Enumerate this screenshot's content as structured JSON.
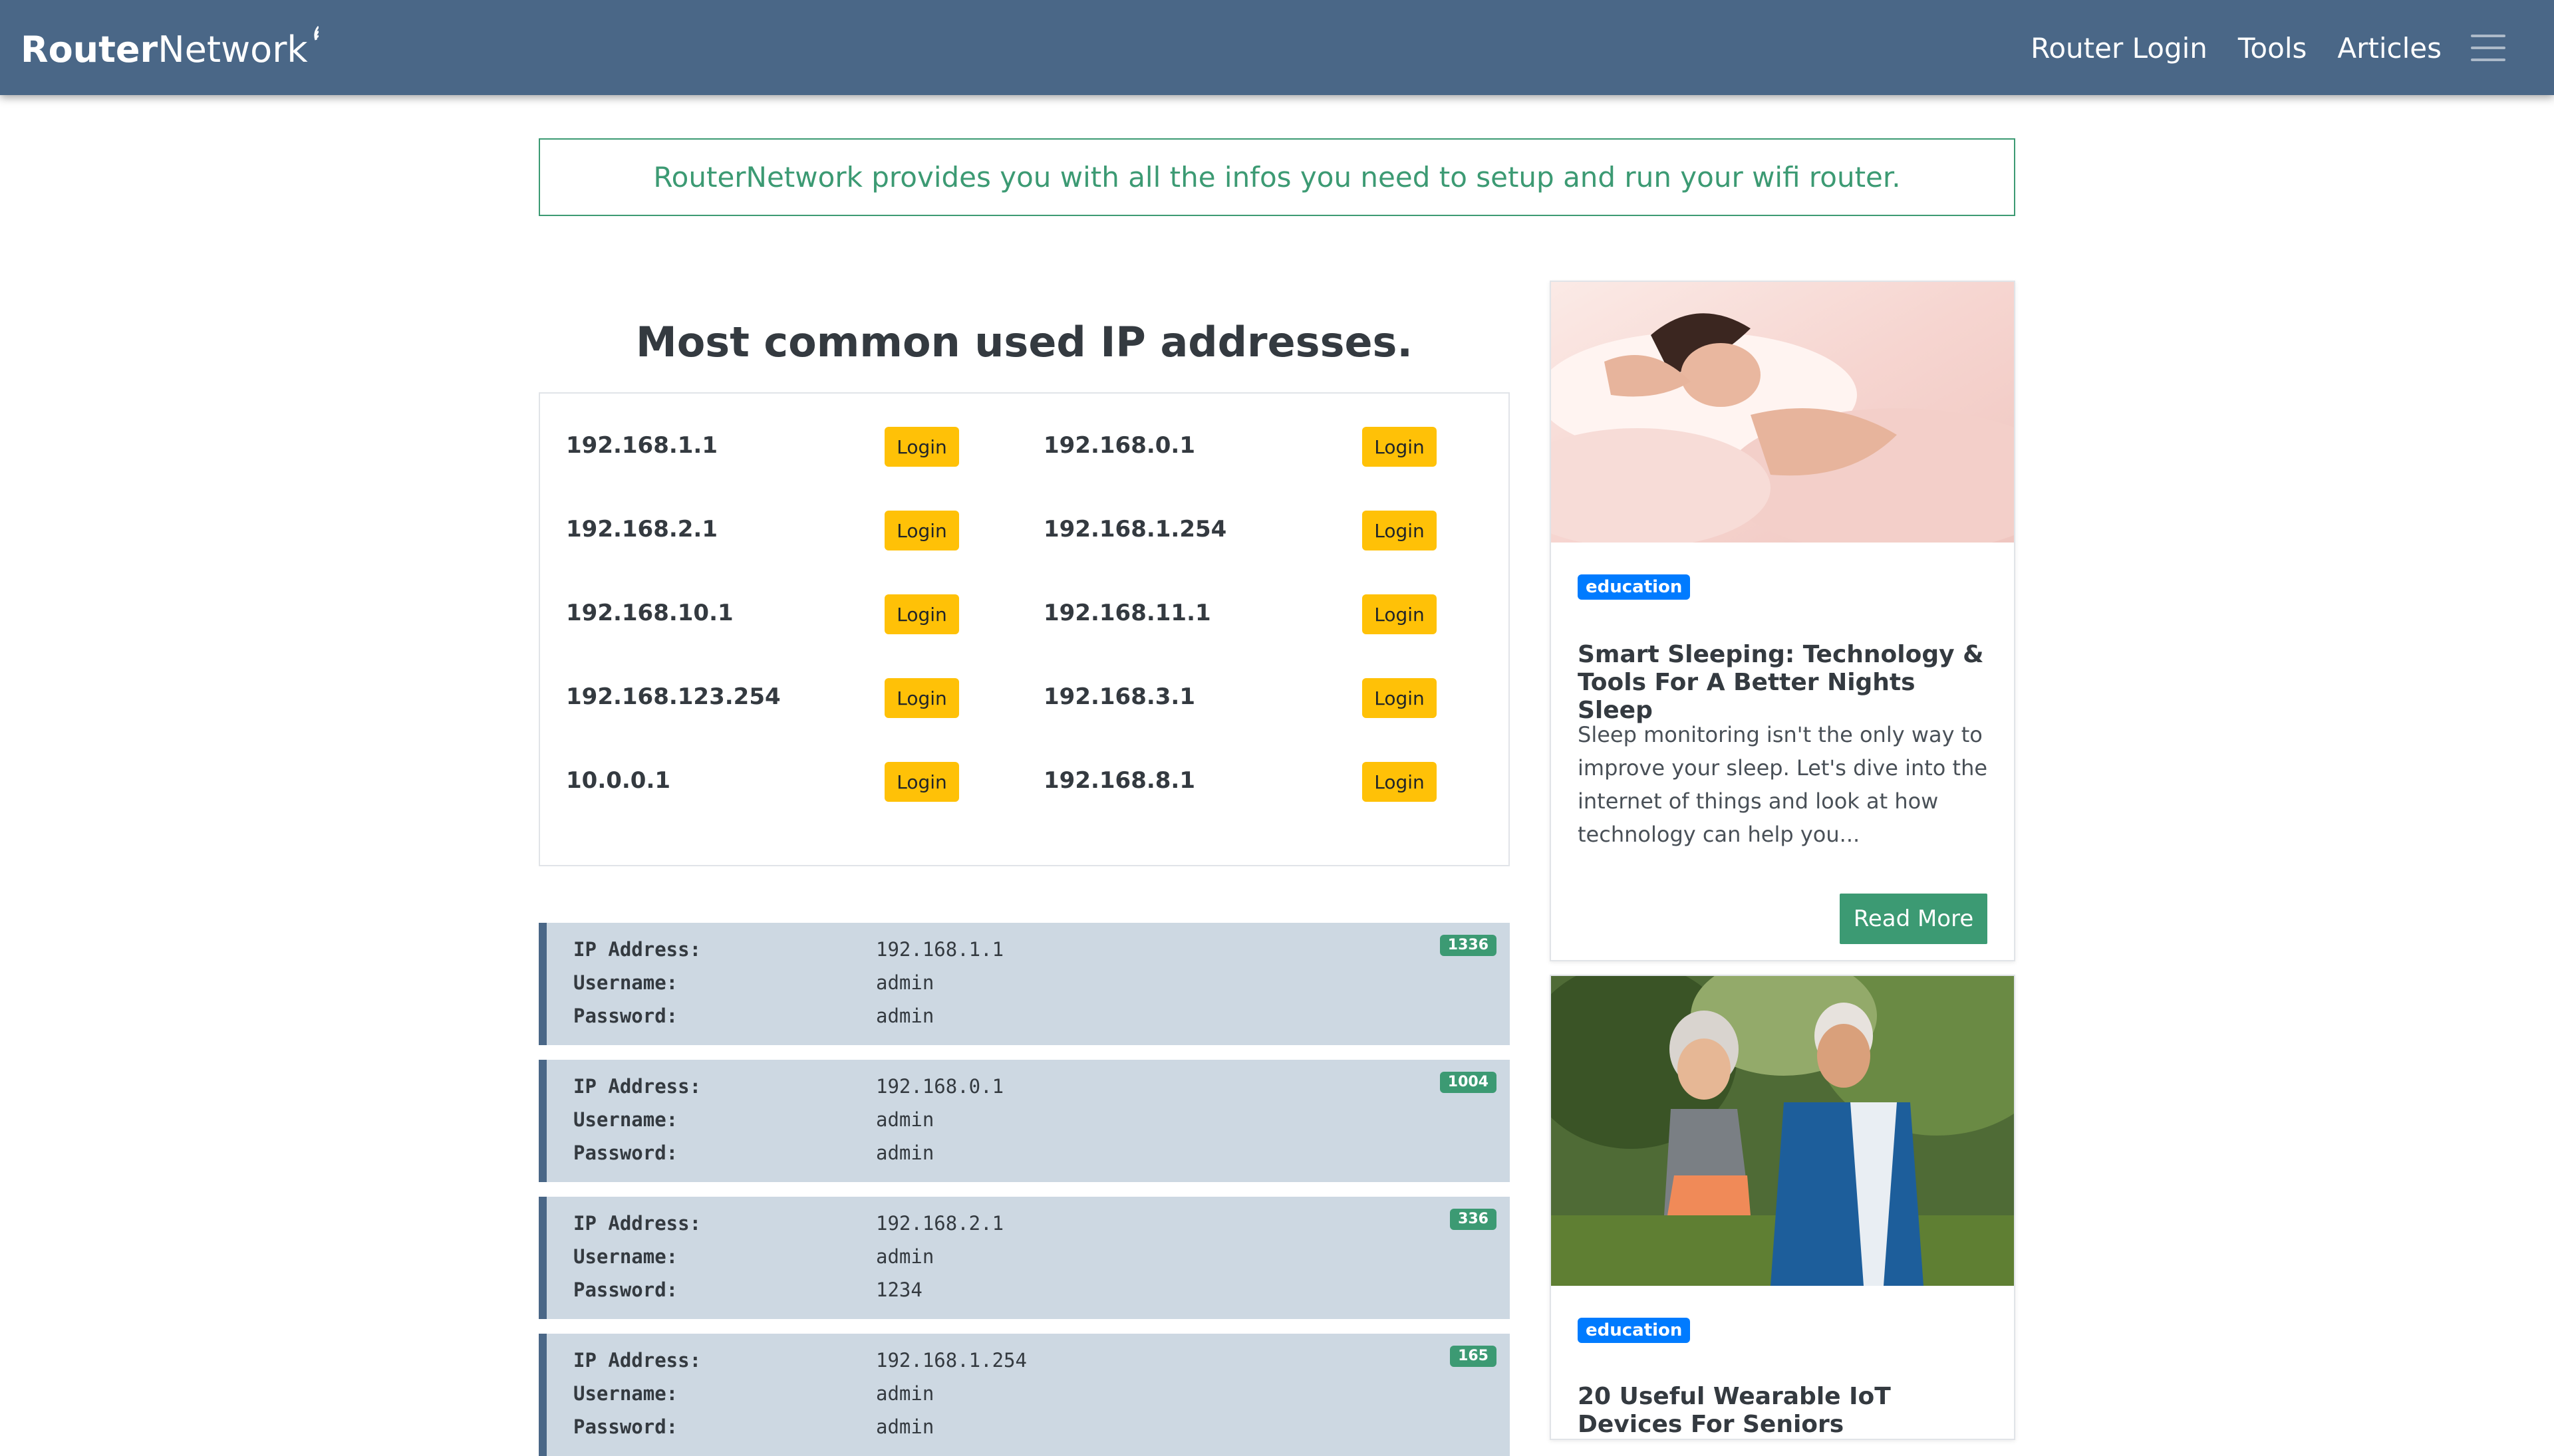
{
  "brand": {
    "part1": "Router",
    "part2": "Network"
  },
  "nav": {
    "links": [
      "Router Login",
      "Tools",
      "Articles"
    ]
  },
  "info_text": "RouterNetwork provides you with all the infos you need to setup and run your wifi router.",
  "section_title": "Most common used IP addresses.",
  "ip_grid": [
    {
      "left_ip": "192.168.1.1",
      "right_ip": "192.168.0.1"
    },
    {
      "left_ip": "192.168.2.1",
      "right_ip": "192.168.1.254"
    },
    {
      "left_ip": "192.168.10.1",
      "right_ip": "192.168.11.1"
    },
    {
      "left_ip": "192.168.123.254",
      "right_ip": "192.168.3.1"
    },
    {
      "left_ip": "10.0.0.1",
      "right_ip": "192.168.8.1"
    }
  ],
  "login_label": "Login",
  "cred_labels": {
    "ip": "IP Address:",
    "user": "Username:",
    "pass": "Password:"
  },
  "credentials": [
    {
      "ip": "192.168.1.1",
      "username": "admin",
      "password": "admin",
      "count": "1336"
    },
    {
      "ip": "192.168.0.1",
      "username": "admin",
      "password": "admin",
      "count": "1004"
    },
    {
      "ip": "192.168.2.1",
      "username": "admin",
      "password": "1234",
      "count": "336"
    },
    {
      "ip": "192.168.1.254",
      "username": "admin",
      "password": "admin",
      "count": "165"
    }
  ],
  "articles": [
    {
      "category": "education",
      "title": "Smart Sleeping: Technology & Tools For A Better Nights Sleep",
      "excerpt": "Sleep monitoring isn't the only way to improve your sleep. Let's dive into the internet of things and look at how technology can help you...",
      "button": "Read More"
    },
    {
      "category": "education",
      "title": "20 Useful Wearable IoT Devices For Seniors"
    }
  ],
  "colors": {
    "navbar": "#4a6787",
    "accent_green": "#3c9a73",
    "login_yellow": "#ffc107",
    "badge_blue": "#007bff",
    "cred_bg": "#cdd8e2"
  },
  "icons": [
    "wifi-signal-icon",
    "hamburger-menu-icon"
  ]
}
